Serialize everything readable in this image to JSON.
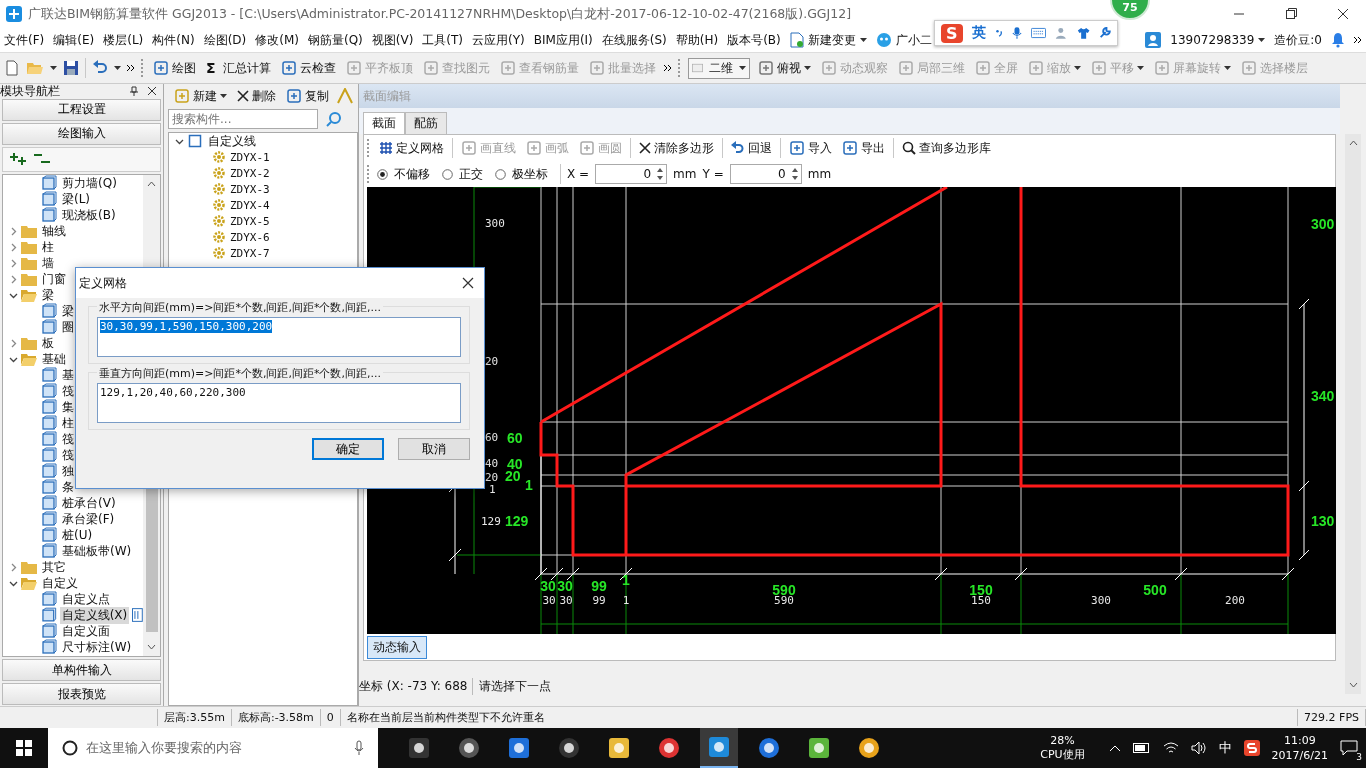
{
  "window": {
    "title": "广联达BIM钢筋算量软件 GGJ2013 - [C:\\Users\\Administrator.PC-20141127NRHM\\Desktop\\白龙村-2017-06-12-10-02-47(2168版).GGJ12]",
    "badge": "75"
  },
  "menu": [
    "文件(F)",
    "编辑(E)",
    "楼层(L)",
    "构件(N)",
    "绘图(D)",
    "修改(M)",
    "钢筋量(Q)",
    "视图(V)",
    "工具(T)",
    "云应用(Y)",
    "BIM应用(I)",
    "在线服务(S)",
    "帮助(H)",
    "版本号(B)"
  ],
  "menu_extras": [
    {
      "label": "新建变更",
      "kind": "dropdown"
    },
    {
      "label": "广小二",
      "kind": "assistant"
    }
  ],
  "ime_toolbar": {
    "logo": "S",
    "mode": "英"
  },
  "account": {
    "phone": "13907298339",
    "beans": "造价豆:0"
  },
  "toolbar": [
    {
      "label": "绘图",
      "kind": "button",
      "disabled": false
    },
    {
      "label": "汇总计算",
      "kind": "glyph",
      "glyph": "Σ",
      "disabled": false
    },
    {
      "label": "云检查",
      "kind": "button",
      "disabled": false
    },
    {
      "label": "平齐板顶",
      "kind": "button",
      "disabled": true
    },
    {
      "label": "查找图元",
      "kind": "button",
      "disabled": true
    },
    {
      "label": "查看钢筋量",
      "kind": "button",
      "disabled": true
    },
    {
      "label": "批量选择",
      "kind": "button",
      "disabled": true
    }
  ],
  "view_toolbar": [
    {
      "label": "二维",
      "kind": "select"
    },
    {
      "label": "俯视",
      "kind": "dropdown",
      "disabled": false
    },
    {
      "label": "动态观察",
      "kind": "button",
      "disabled": true
    },
    {
      "label": "局部三维",
      "kind": "button",
      "disabled": true
    },
    {
      "label": "全屏",
      "kind": "button",
      "disabled": true
    },
    {
      "label": "缩放",
      "kind": "dropdown",
      "disabled": true
    },
    {
      "label": "平移",
      "kind": "dropdown",
      "disabled": true
    },
    {
      "label": "屏幕旋转",
      "kind": "dropdown",
      "disabled": true
    },
    {
      "label": "选择楼层",
      "kind": "button",
      "disabled": true
    }
  ],
  "nav": {
    "title": "模块导航栏",
    "sections": [
      "工程设置",
      "绘图输入"
    ],
    "tree": [
      {
        "kind": "group",
        "children": [
          {
            "kind": "item",
            "label": "剪力墙(Q)",
            "selected": false
          },
          {
            "kind": "item",
            "label": "梁(L)",
            "selected": false
          },
          {
            "kind": "item",
            "label": "现浇板(B)",
            "selected": false
          }
        ]
      },
      {
        "kind": "folder",
        "label": "轴线",
        "expanded": false
      },
      {
        "kind": "folder",
        "label": "柱",
        "expanded": false
      },
      {
        "kind": "folder",
        "label": "墙",
        "expanded": false
      },
      {
        "kind": "folder",
        "label": "门窗",
        "expanded": false
      },
      {
        "kind": "folder",
        "label": "梁",
        "expanded": true,
        "children": [
          {
            "kind": "item",
            "label": "梁",
            "selected": false
          },
          {
            "kind": "item",
            "label": "圈",
            "selected": false
          }
        ]
      },
      {
        "kind": "folder",
        "label": "板",
        "expanded": false
      },
      {
        "kind": "folder",
        "label": "基础",
        "expanded": true,
        "children": [
          {
            "kind": "item",
            "label": "基",
            "selected": false
          },
          {
            "kind": "item",
            "label": "筏",
            "selected": false
          },
          {
            "kind": "item",
            "label": "集",
            "selected": false
          },
          {
            "kind": "item",
            "label": "柱",
            "selected": false
          },
          {
            "kind": "item",
            "label": "筏",
            "selected": false
          },
          {
            "kind": "item",
            "label": "筏",
            "selected": false
          },
          {
            "kind": "item",
            "label": "独",
            "selected": false
          },
          {
            "kind": "item",
            "label": "条",
            "selected": false
          },
          {
            "kind": "item",
            "label": "桩承台(V)",
            "selected": false
          },
          {
            "kind": "item",
            "label": "承台梁(F)",
            "selected": false
          },
          {
            "kind": "item",
            "label": "桩(U)",
            "selected": false
          },
          {
            "kind": "item",
            "label": "基础板带(W)",
            "selected": false
          }
        ]
      },
      {
        "kind": "folder",
        "label": "其它",
        "expanded": false
      },
      {
        "kind": "folder",
        "label": "自定义",
        "expanded": true,
        "children": [
          {
            "kind": "item",
            "label": "自定义点",
            "selected": false
          },
          {
            "kind": "item",
            "label": "自定义线(X)",
            "selected": true
          },
          {
            "kind": "item",
            "label": "自定义面",
            "selected": false
          },
          {
            "kind": "item",
            "label": "尺寸标注(W)",
            "selected": false
          }
        ]
      }
    ],
    "bottom_sections": [
      "单构件输入",
      "报表预览"
    ]
  },
  "component_panel": {
    "toolbar": [
      {
        "label": "新建",
        "kind": "dropdown"
      },
      {
        "label": "删除",
        "kind": "button"
      },
      {
        "label": "复制",
        "kind": "button"
      }
    ],
    "search": {
      "placeholder": "搜索构件..."
    },
    "tree": [
      {
        "label": "自定义线",
        "expanded": true,
        "children": [
          {
            "label": "ZDYX-1",
            "selected": false
          },
          {
            "label": "ZDYX-2",
            "selected": false
          },
          {
            "label": "ZDYX-3",
            "selected": false
          },
          {
            "label": "ZDYX-4",
            "selected": false
          },
          {
            "label": "ZDYX-5",
            "selected": false
          },
          {
            "label": "ZDYX-6",
            "selected": false
          },
          {
            "label": "ZDYX-7",
            "selected": false
          }
        ]
      }
    ]
  },
  "editor": {
    "title": "截面编辑",
    "tabs": [
      {
        "label": "截面",
        "selected": true
      },
      {
        "label": "配筋",
        "selected": false
      }
    ],
    "tools": [
      {
        "label": "定义网格",
        "disabled": false
      },
      {
        "label": "画直线",
        "disabled": true
      },
      {
        "label": "画弧",
        "disabled": true
      },
      {
        "label": "画圆",
        "disabled": true
      },
      {
        "label": "清除多边形",
        "disabled": false
      },
      {
        "label": "回退",
        "disabled": false
      },
      {
        "label": "导入",
        "disabled": false
      },
      {
        "label": "导出",
        "disabled": false
      },
      {
        "label": "查询多边形库",
        "disabled": false
      }
    ],
    "snap_modes": [
      {
        "label": "不偏移",
        "selected": true
      },
      {
        "label": "正交",
        "selected": false
      },
      {
        "label": "极坐标",
        "selected": false
      }
    ],
    "x_field": {
      "label": "X =",
      "value": "0",
      "unit": "mm"
    },
    "y_field": {
      "label": "Y =",
      "value": "0",
      "unit": "mm"
    },
    "canvas": {
      "left_labels": [
        "300",
        "20",
        "60",
        "40",
        "20",
        "1",
        "129"
      ],
      "left_dims": [
        "60",
        "40",
        "20",
        "1",
        "129"
      ],
      "right_dims": [
        "300",
        "340",
        "130"
      ],
      "bottom_dims": [
        "30",
        "30",
        "99",
        "1",
        "590",
        "150",
        "500"
      ],
      "bottom_labels": [
        "30",
        "30",
        "99",
        "1",
        "590",
        "150",
        "300",
        "200"
      ]
    },
    "dynamic_input": {
      "label": "动态输入",
      "on": true
    },
    "coords": "坐标 (X: -73 Y: 688",
    "prompt": "请选择下一点"
  },
  "dialog": {
    "title": "定义网格",
    "groups": [
      {
        "label": "水平方向间距(mm)=>间距*个数,间距,间距*个数,间距,...",
        "value": "30,30,99,1,590,150,300,200",
        "selected": true
      },
      {
        "label": "垂直方向间距(mm)=>间距*个数,间距,间距*个数,间距,...",
        "value": "129,1,20,40,60,220,300",
        "selected": false
      }
    ],
    "buttons": [
      {
        "label": "确定",
        "default": true
      },
      {
        "label": "取消",
        "default": false
      }
    ]
  },
  "status_bar": [
    "层高:3.55m",
    "底标高:-3.58m",
    "0",
    "名称在当前层当前构件类型下不允许重名",
    "729.2 FPS"
  ],
  "taskbar": {
    "search_placeholder": "在这里输入你要搜索的内容",
    "apps": [
      {
        "selected": false
      },
      {
        "selected": false
      },
      {
        "selected": false
      },
      {
        "selected": false
      },
      {
        "selected": false
      },
      {
        "selected": false
      },
      {
        "selected": true
      },
      {
        "selected": false
      },
      {
        "selected": false
      },
      {
        "selected": false
      }
    ],
    "cpu": {
      "value": "28%",
      "label": "CPU使用"
    },
    "ime": "中",
    "time": "11:09",
    "date": "2017/6/21",
    "notifications": "3"
  }
}
